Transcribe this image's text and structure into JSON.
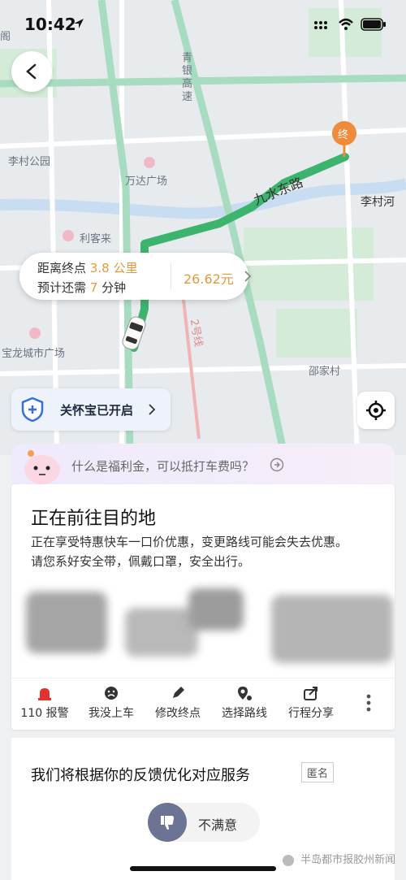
{
  "status_bar": {
    "time": "10:42"
  },
  "map": {
    "labels": {
      "top_left": "阁",
      "qingyin": "青银高速",
      "licun_park": "李村公园",
      "wanda": "万达广场",
      "likelai": "利客来",
      "jiushui": "九水东路",
      "licun_river": "李村河",
      "baolong": "宝龙城市广场",
      "shaojia": "邵家村",
      "line2": "2号线",
      "end_marker": "终"
    },
    "route_color": "#3cb46e"
  },
  "trip_info": {
    "distance_prefix": "距离终点",
    "distance_value": "3.8",
    "distance_unit": "公里",
    "eta_prefix": "预计还需",
    "eta_value": "7",
    "eta_unit": "分钟",
    "fare": "26.62元"
  },
  "care": {
    "label": "关怀宝已开启"
  },
  "welfare_banner": {
    "text": "什么是福利金，可以抵打车费吗？"
  },
  "status_card": {
    "title": "正在前往目的地",
    "line1": "正在享受特惠快车一口价优惠，变更路线可能会失去优惠。",
    "line2": "请您系好安全带，佩戴口罩，安全出行。"
  },
  "actions": [
    {
      "label": "110 报警",
      "icon": "alarm-icon"
    },
    {
      "label": "我没上车",
      "icon": "sad-face-icon"
    },
    {
      "label": "修改终点",
      "icon": "pencil-icon"
    },
    {
      "label": "选择路线",
      "icon": "route-icon"
    },
    {
      "label": "行程分享",
      "icon": "share-icon"
    }
  ],
  "feedback": {
    "title": "我们将根据你的反馈优化对应服务",
    "anonymous": "匿名",
    "dislike_label": "不满意"
  },
  "watermark": "半岛都市报胶州新闻"
}
